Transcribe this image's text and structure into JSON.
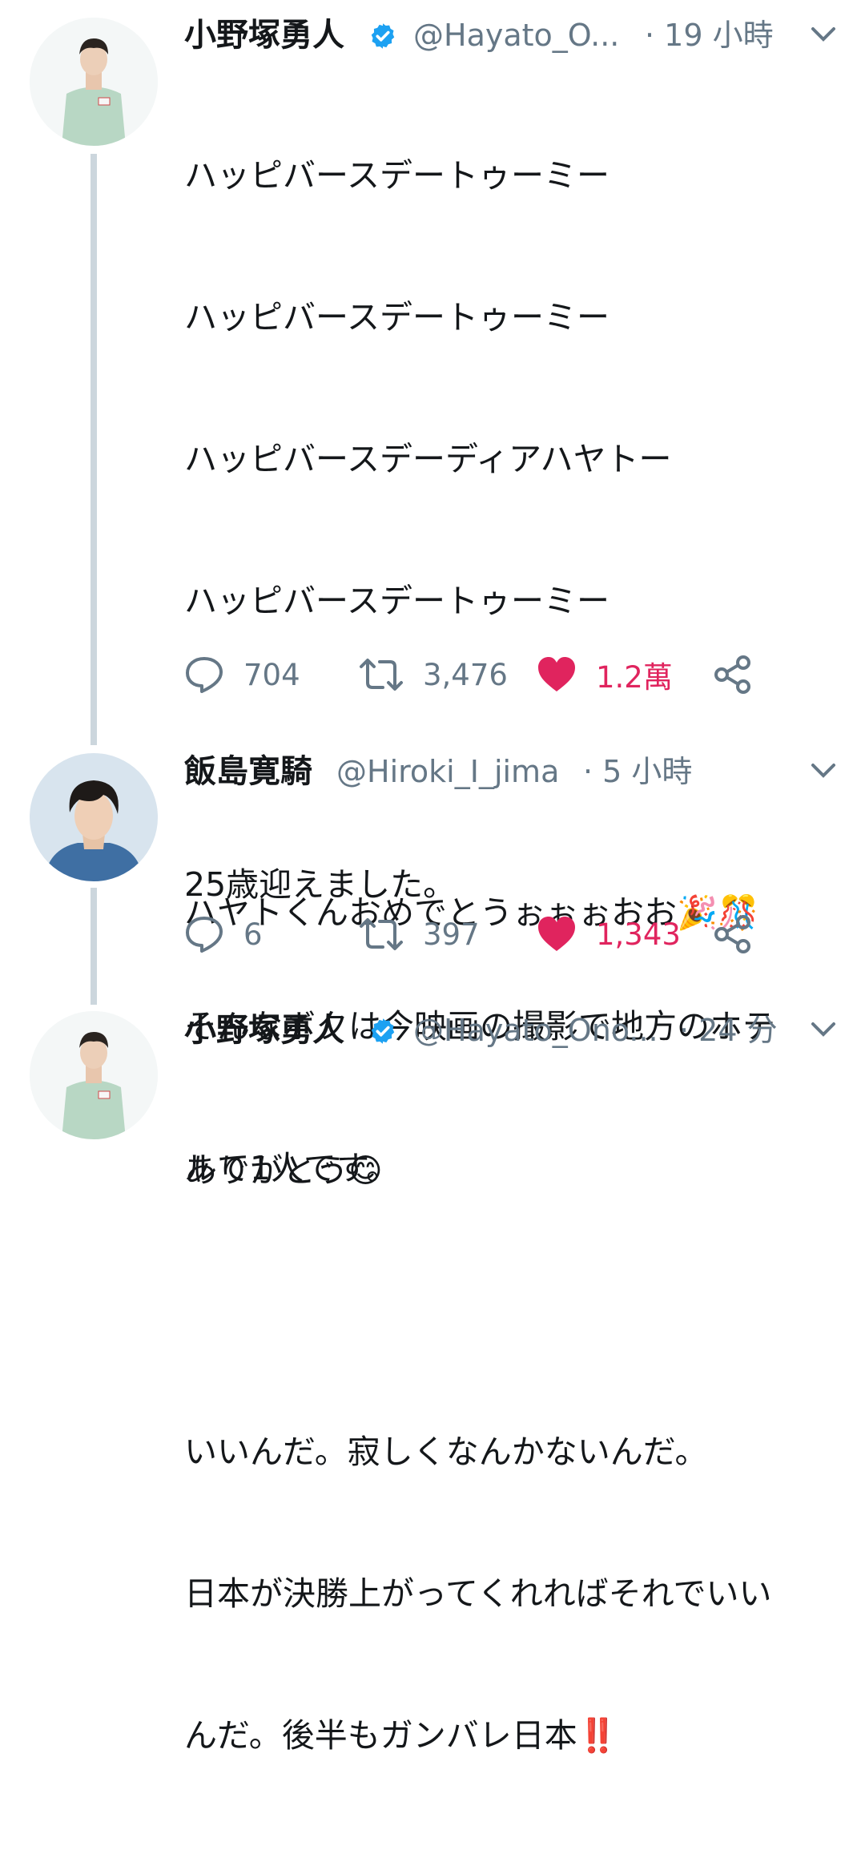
{
  "tweets": [
    {
      "name": "小野塚勇人",
      "handle": "@Hayato_O...",
      "time": "· 19 小時",
      "verified": true,
      "lines": [
        "ハッピバースデートゥーミー",
        "ハッピバースデートゥーミー",
        "ハッピバースデーディアハヤトー",
        "ハッピバースデートゥーミー",
        "",
        "25歳迎えました。",
        "そんなボクは今映画の撮影で地方のホテ",
        "ルで1人です。",
        "",
        "いいんだ。寂しくなんかないんだ。",
        "日本が決勝上がってくれればそれでいい",
        "んだ。後半もガンバレ日本‼️"
      ],
      "replies": "704",
      "retweets": "3,476",
      "likes": "1.2萬"
    },
    {
      "name": "飯島寛騎",
      "handle": "@Hiroki_I_jima",
      "time": "· 5 小時",
      "verified": false,
      "lines": [
        "ハヤトくんおめでとうぉぉぉおお🎉🎊"
      ],
      "replies": "6",
      "retweets": "397",
      "likes": "1,343"
    },
    {
      "name": "小野塚勇人",
      "handle": "@Hayato_Ono...",
      "time": "· 24 分",
      "verified": true,
      "lines": [
        "ありがとう😊"
      ]
    }
  ],
  "colors": {
    "text": "#14171a",
    "secondary": "#657786",
    "like": "#e0245e",
    "verified": "#1da1f2",
    "thread_line": "#ccd6dd"
  },
  "icons": [
    "verified-badge-icon",
    "chevron-down-icon",
    "reply-icon",
    "retweet-icon",
    "heart-icon",
    "share-icon"
  ]
}
